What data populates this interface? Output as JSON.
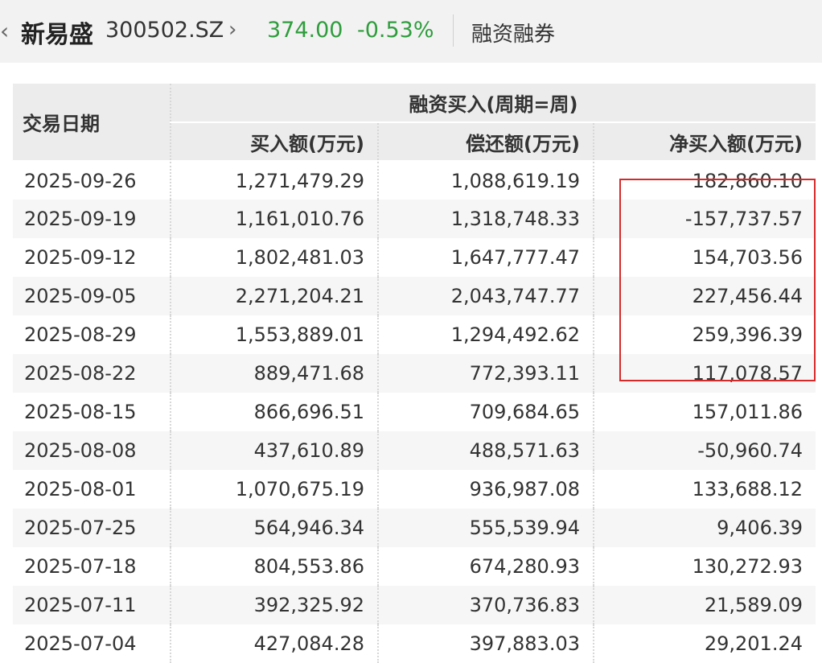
{
  "header": {
    "back_icon": "chevron-left",
    "stock_name": "新易盛",
    "stock_code": "300502.SZ",
    "forward_icon": "chevron-right",
    "price": "374.00",
    "change": "-0.53%",
    "price_color": "#2e9d3c",
    "tag": "融资融券"
  },
  "table": {
    "date_header": "交易日期",
    "group_header": "融资买入(周期=周)",
    "columns": [
      "买入额(万元)",
      "偿还额(万元)",
      "净买入额(万元)"
    ],
    "rows": [
      [
        "2025-09-26",
        "1,271,479.29",
        "1,088,619.19",
        "182,860.10"
      ],
      [
        "2025-09-19",
        "1,161,010.76",
        "1,318,748.33",
        "-157,737.57"
      ],
      [
        "2025-09-12",
        "1,802,481.03",
        "1,647,777.47",
        "154,703.56"
      ],
      [
        "2025-09-05",
        "2,271,204.21",
        "2,043,747.77",
        "227,456.44"
      ],
      [
        "2025-08-29",
        "1,553,889.01",
        "1,294,492.62",
        "259,396.39"
      ],
      [
        "2025-08-22",
        "889,471.68",
        "772,393.11",
        "117,078.57"
      ],
      [
        "2025-08-15",
        "866,696.51",
        "709,684.65",
        "157,011.86"
      ],
      [
        "2025-08-08",
        "437,610.89",
        "488,571.63",
        "-50,960.74"
      ],
      [
        "2025-08-01",
        "1,070,675.19",
        "936,987.08",
        "133,688.12"
      ],
      [
        "2025-07-25",
        "564,946.34",
        "555,539.94",
        "9,406.39"
      ],
      [
        "2025-07-18",
        "804,553.86",
        "674,280.93",
        "130,272.93"
      ],
      [
        "2025-07-11",
        "392,325.92",
        "370,736.83",
        "21,589.09"
      ],
      [
        "2025-07-04",
        "427,084.28",
        "397,883.03",
        "29,201.24"
      ]
    ]
  },
  "highlight_color": "#d62a2a"
}
